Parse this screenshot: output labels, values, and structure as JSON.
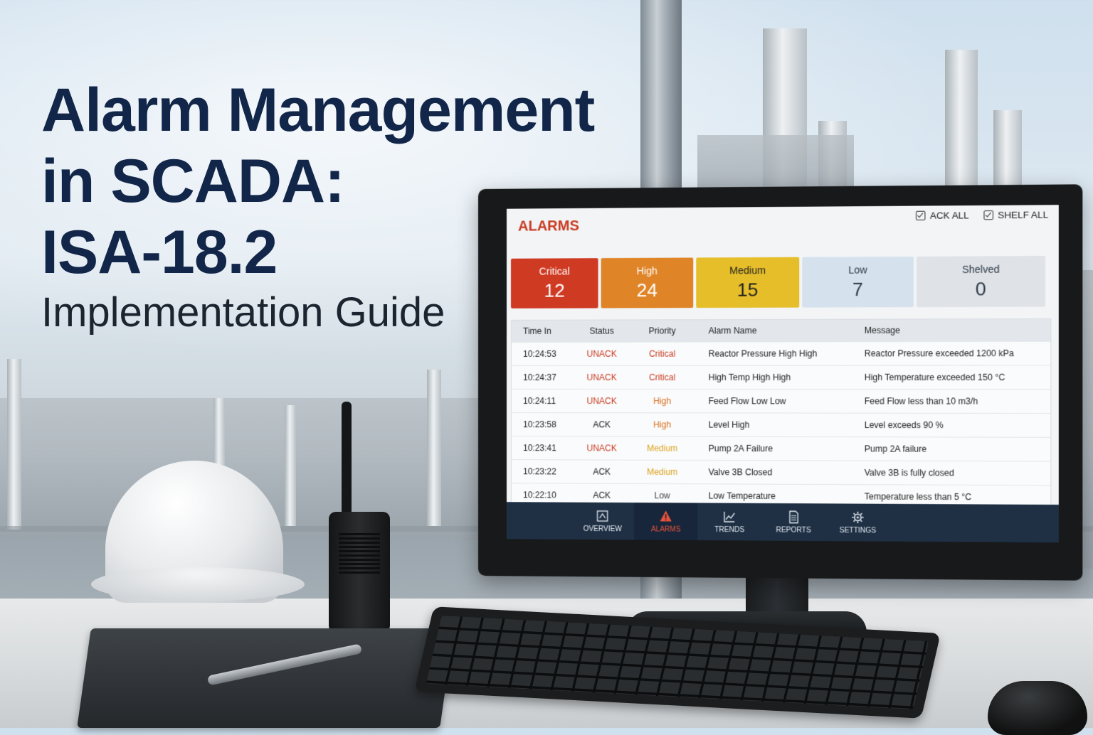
{
  "poster": {
    "title_line1": "Alarm Management",
    "title_line2": "in SCADA:",
    "title_line3": "ISA-18.2",
    "subtitle": "Implementation Guide"
  },
  "screen": {
    "header_title": "ALARMS",
    "actions": [
      {
        "label": "ACK ALL",
        "icon": "checkbox-icon"
      },
      {
        "label": "SHELF ALL",
        "icon": "checkbox-icon"
      }
    ],
    "counts": [
      {
        "label": "Critical",
        "value": "12",
        "color": "#cf3a23"
      },
      {
        "label": "High",
        "value": "24",
        "color": "#e08428"
      },
      {
        "label": "Medium",
        "value": "15",
        "color": "#e6be2a"
      },
      {
        "label": "Low",
        "value": "7",
        "color": "#d5e2ee"
      },
      {
        "label": "Shelved",
        "value": "0",
        "color": "#dfe2e6"
      }
    ],
    "columns": [
      "Time In",
      "Status",
      "Priority",
      "Alarm Name",
      "Message"
    ],
    "rows": [
      {
        "time": "10:24:53",
        "status": "UNACK",
        "priority": "Critical",
        "name": "Reactor Pressure High High",
        "message": "Reactor Pressure exceeded 1200 kPa"
      },
      {
        "time": "10:24:37",
        "status": "UNACK",
        "priority": "Critical",
        "name": "High Temp High High",
        "message": "High Temperature exceeded 150 °C"
      },
      {
        "time": "10:24:11",
        "status": "UNACK",
        "priority": "High",
        "name": "Feed Flow Low Low",
        "message": "Feed Flow less than 10 m3/h"
      },
      {
        "time": "10:23:58",
        "status": "ACK",
        "priority": "High",
        "name": "Level High",
        "message": "Level exceeds 90 %"
      },
      {
        "time": "10:23:41",
        "status": "UNACK",
        "priority": "Medium",
        "name": "Pump 2A Failure",
        "message": "Pump 2A failure"
      },
      {
        "time": "10:23:22",
        "status": "ACK",
        "priority": "Medium",
        "name": "Valve 3B Closed",
        "message": "Valve 3B is fully closed"
      },
      {
        "time": "10:22:10",
        "status": "ACK",
        "priority": "Low",
        "name": "Low Temperature",
        "message": "Temperature less than 5 °C"
      }
    ],
    "nav": [
      {
        "label": "OVERVIEW",
        "icon": "overview-icon",
        "active": false
      },
      {
        "label": "ALARMS",
        "icon": "alarm-warning-icon",
        "active": true
      },
      {
        "label": "TRENDS",
        "icon": "trends-chart-icon",
        "active": false
      },
      {
        "label": "REPORTS",
        "icon": "reports-document-icon",
        "active": false
      },
      {
        "label": "SETTINGS",
        "icon": "gear-icon",
        "active": false
      }
    ],
    "colors": {
      "alarm_red": "#c93a1f",
      "nav_bg": "#1f3045",
      "title_navy": "#12264a"
    }
  }
}
